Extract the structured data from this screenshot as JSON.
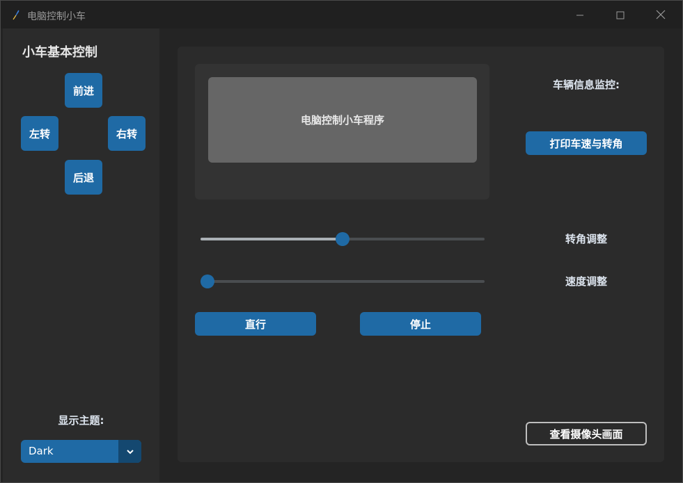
{
  "window": {
    "title": "电脑控制小车",
    "controls": {
      "minimize": "minimize-icon",
      "maximize": "maximize-icon",
      "close": "close-icon"
    }
  },
  "sidebar": {
    "title": "小车基本控制",
    "buttons": {
      "forward": "前进",
      "left": "左转",
      "right": "右转",
      "backward": "后退"
    },
    "theme_label": "显示主题:",
    "theme_value": "Dark"
  },
  "main": {
    "display_text": "电脑控制小车程序",
    "monitor_label": "车辆信息监控:",
    "print_button": "打印车速与转角",
    "angle_label": "转角调整",
    "speed_label": "速度调整",
    "angle_slider_value": 0.5,
    "speed_slider_value": 0.0,
    "straight_button": "直行",
    "stop_button": "停止",
    "camera_button": "查看摄像头画面"
  },
  "colors": {
    "accent": "#1f6aa5",
    "background": "#242424",
    "panel": "#2b2b2b"
  }
}
